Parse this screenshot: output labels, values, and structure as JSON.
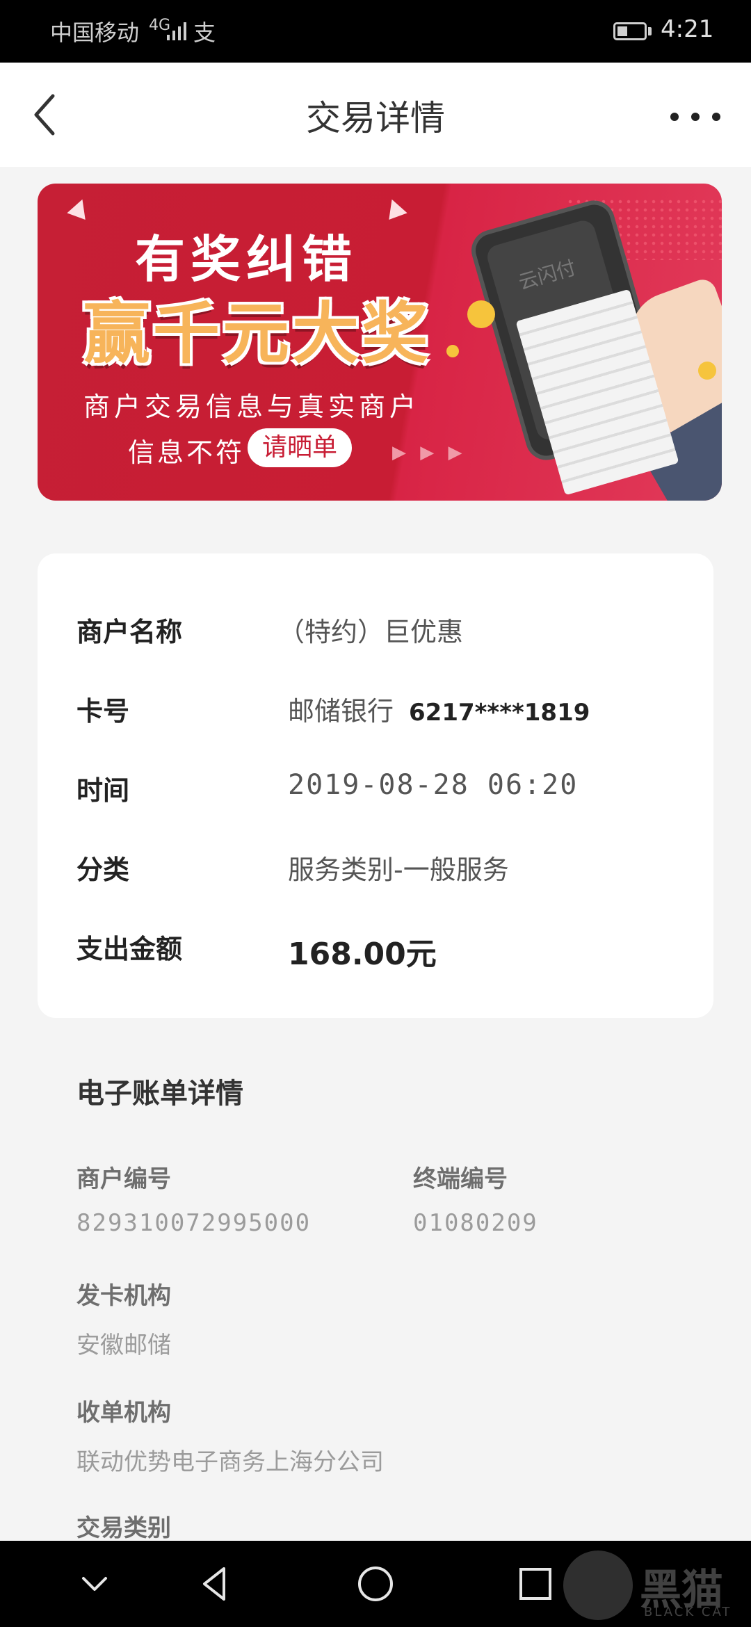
{
  "status_bar": {
    "carrier": "中国移动",
    "network": "4G",
    "extra_icon": "支",
    "time": "4:21"
  },
  "header": {
    "title": "交易详情"
  },
  "banner": {
    "headline": "有奖纠错",
    "prize": "赢千元大奖",
    "line1": "商户交易信息与真实商户",
    "line2": "信息不符",
    "cta": "请晒单",
    "arrows": "▶ ▶ ▶",
    "phone_logo": "云闪付"
  },
  "transaction": {
    "merchant_label": "商户名称",
    "merchant_value": "（特约）巨优惠",
    "card_label": "卡号",
    "card_bank": "邮储银行",
    "card_number": "6217****1819",
    "time_label": "时间",
    "time_value": "2019-08-28 06:20",
    "category_label": "分类",
    "category_value": "服务类别-一般服务",
    "amount_label": "支出金额",
    "amount_value": "168.00元"
  },
  "bill": {
    "title": "电子账单详情",
    "merchant_no_label": "商户编号",
    "merchant_no_value": "829310072995000",
    "terminal_no_label": "终端编号",
    "terminal_no_value": "01080209",
    "issuer_label": "发卡机构",
    "issuer_value": "安徽邮储",
    "acquirer_label": "收单机构",
    "acquirer_value": "联动优势电子商务上海分公司",
    "trans_type_label": "交易类别"
  },
  "watermark": {
    "text": "黑猫",
    "sub": "BLACK CAT"
  }
}
